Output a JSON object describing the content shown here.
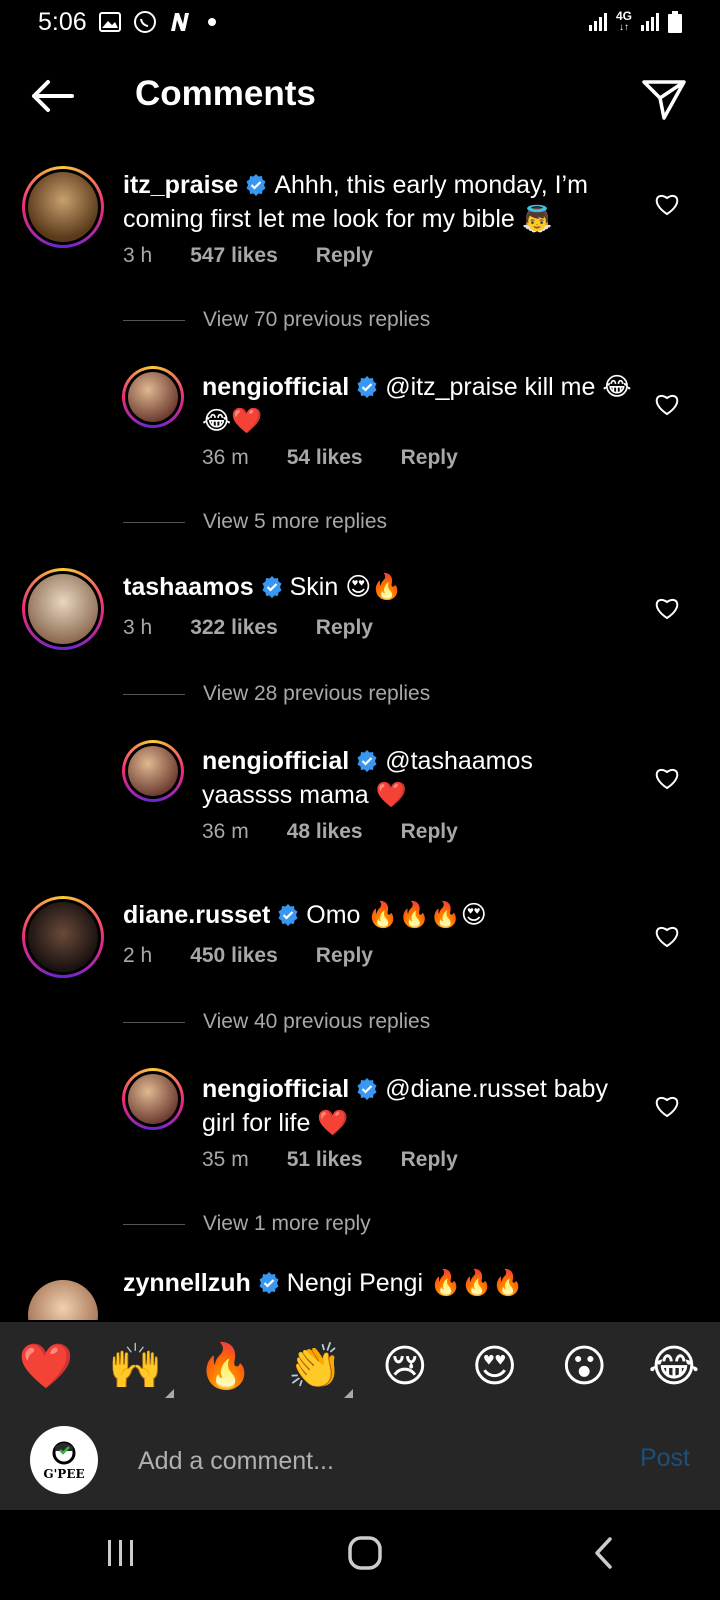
{
  "status_bar": {
    "time": "5:06",
    "network": "4G"
  },
  "header": {
    "title": "Comments"
  },
  "comments": [
    {
      "user": "itz_praise",
      "text": "Ahhh, this early monday, I’m coming first let me look for my bible 👼",
      "time": "3 h",
      "likes": "547 likes",
      "reply": "Reply"
    },
    {
      "user": "nengiofficial",
      "text": "@itz_praise kill me 😂😂❤️",
      "time": "36 m",
      "likes": "54 likes",
      "reply": "Reply"
    },
    {
      "user": "tashaamos",
      "text": "Skin 😍🔥",
      "time": "3 h",
      "likes": "322 likes",
      "reply": "Reply"
    },
    {
      "user": "nengiofficial",
      "text": "@tashaamos yaassss mama ❤️",
      "time": "36 m",
      "likes": "48 likes",
      "reply": "Reply"
    },
    {
      "user": "diane.russet",
      "text": "Omo 🔥🔥🔥😍",
      "time": "2 h",
      "likes": "450 likes",
      "reply": "Reply"
    },
    {
      "user": "nengiofficial",
      "text": "@diane.russet baby girl for life ❤️",
      "time": "35 m",
      "likes": "51 likes",
      "reply": "Reply"
    },
    {
      "user": "zynnellzuh",
      "text": "Nengi Pengi 🔥🔥🔥"
    }
  ],
  "view_more": [
    "View 70 previous replies",
    "View 5 more replies",
    "View 28 previous replies",
    "View 40 previous replies",
    "View 1 more reply"
  ],
  "reactions": [
    "❤️",
    "🙌",
    "🔥",
    "👏",
    "😢",
    "😍",
    "😮",
    "😂"
  ],
  "composer": {
    "avatar_text": "G'PEE",
    "placeholder": "Add a comment...",
    "post_label": "Post"
  },
  "colors": {
    "verified": "#3897f0",
    "muted": "#a8a8a8",
    "post": "#1c4f7a",
    "bar": "#262626"
  }
}
